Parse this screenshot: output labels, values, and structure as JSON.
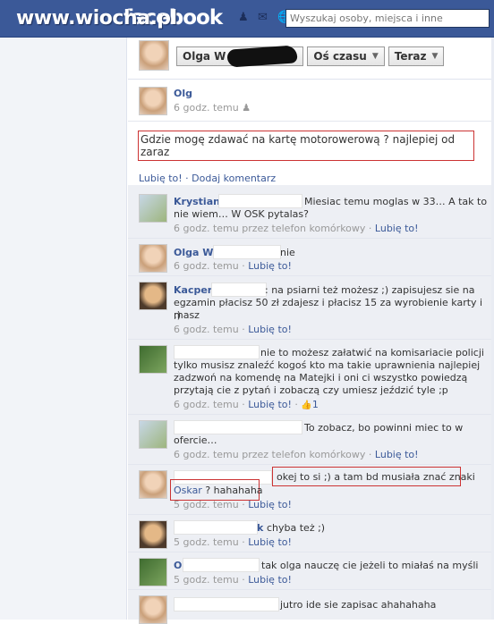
{
  "watermark": "www.wiocha.pl",
  "app": {
    "logo": "facebook"
  },
  "search": {
    "placeholder": "Wyszukaj osoby, miejsca i inne"
  },
  "timeline_nav": {
    "name": "Olga W",
    "axis": "Oś czasu",
    "now": "Teraz"
  },
  "post": {
    "author": "Olg",
    "time": "6 godz. temu",
    "icon": "friends-icon",
    "text": "Gdzie mogę zdawać na kartę motorowerową ? najlepiej od zaraz",
    "like_label": "Lubię to!",
    "comment_label": "Dodaj komentarz"
  },
  "comments": [
    {
      "name": "Krystian",
      "text1": "Miesiac temu moglas w 33… A tak to",
      "text2": "nie wiem… W OSK pytalas?",
      "time": "6 godz. temu przez telefon komórkowy",
      "like": "Lubię to!"
    },
    {
      "name": "Olga W",
      "text1": "nie",
      "time": "6 godz. temu",
      "like": "Lubię to!"
    },
    {
      "name": "Kacper",
      "text1": ": na psiarni też możesz ;) zapisujesz sie na",
      "text2": "egzamin płacisz 50 zł zdajesz i płacisz 15 za wyrobienie karty i masz",
      "text3": ";)",
      "time": "6 godz. temu",
      "like": "Lubię to!"
    },
    {
      "text1": "nie to możesz załatwić na komisariacie policji",
      "text2": "tylko musisz znaleźć kogoś kto ma takie uprawnienia najlepiej",
      "text3": "zadzwoń na komendę na Matejki i oni ci wszystko powiedzą",
      "text4": "przytają cie z pytań i zobaczą czy umiesz jeździć tyle ;p",
      "time": "6 godz. temu",
      "like": "Lubię to!",
      "likes_count": "1"
    },
    {
      "text1": "To zobacz, bo powinni miec to w",
      "text2": "ofercie…",
      "time": "6 godz. temu przez telefon komórkowy",
      "like": "Lubię to!"
    },
    {
      "text1": "okej to si ;) a tam bd musiała znać znaki",
      "mention": "Oskar",
      "text2": "? hahahaha",
      "time": "5 godz. temu",
      "like": "Lubię to!"
    },
    {
      "name_tail": "k",
      "text1": "chyba też ;)",
      "time": "5 godz. temu",
      "like": "Lubię to!"
    },
    {
      "name_head": "O",
      "text1": "tak olga nauczę cie jeżeli to miałaś na myśli",
      "time": "5 godz. temu",
      "like": "Lubię to!"
    },
    {
      "text1": "jutro ide sie zapisac ahahahaha"
    }
  ]
}
